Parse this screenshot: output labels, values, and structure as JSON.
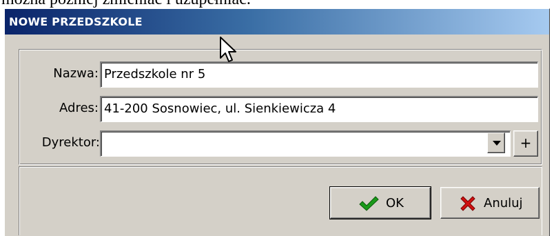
{
  "caption": {
    "text": "można później zmieniać i uzupełniać."
  },
  "dialog": {
    "title": "NOWE PRZEDSZKOLE"
  },
  "form": {
    "name": {
      "label": "Nazwa:",
      "value": "Przedszkole nr 5"
    },
    "address": {
      "label": "Adres:",
      "value": "41-200 Sosnowiec, ul. Sienkiewicza 4"
    },
    "director": {
      "label": "Dyrektor:",
      "value": "",
      "add_label": "+"
    }
  },
  "buttons": {
    "ok": "OK",
    "cancel": "Anuluj"
  },
  "colors": {
    "ok_check": "#1a9a1a",
    "cancel_x": "#d01010",
    "title_start": "#0a246a",
    "title_end": "#a6caf0"
  }
}
